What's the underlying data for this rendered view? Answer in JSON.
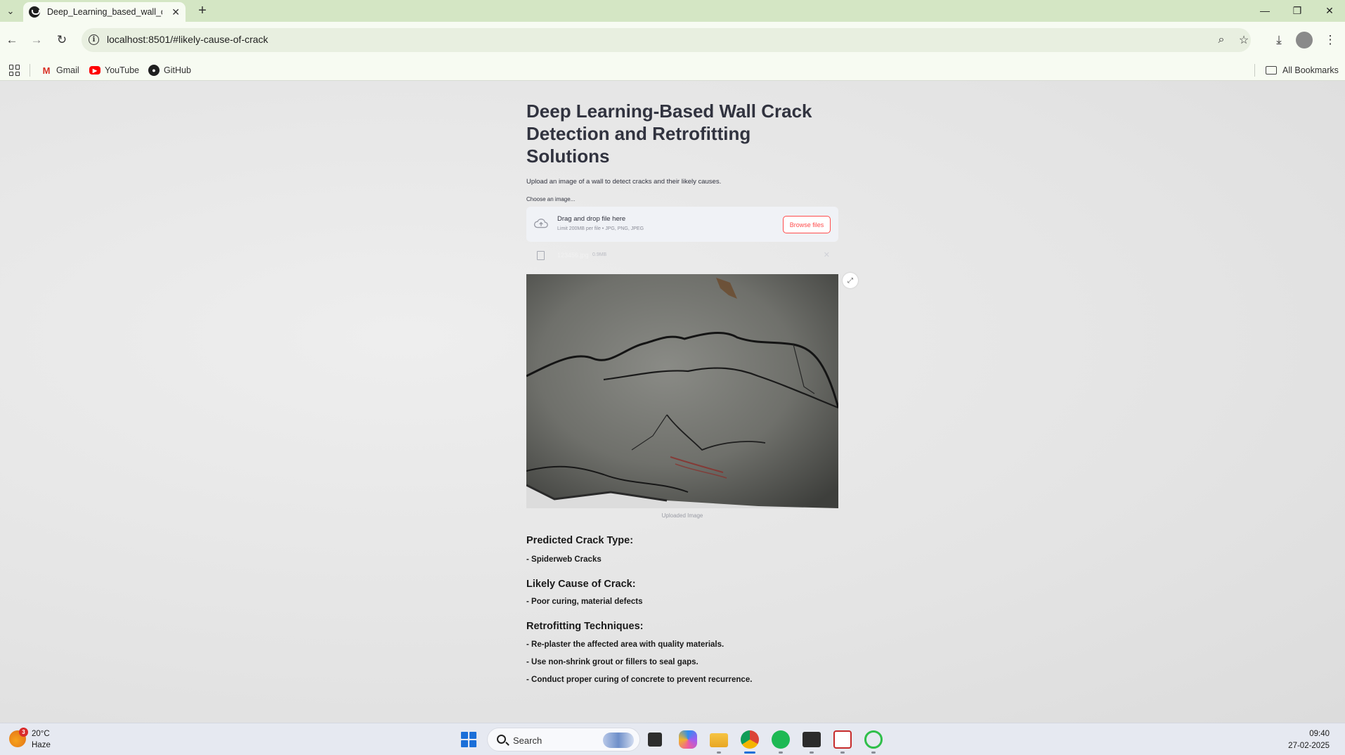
{
  "browser": {
    "tab_title": "Deep_Learning_based_wall_crac",
    "url": "localhost:8501/#likely-cause-of-crack",
    "bookmarks": [
      {
        "label": "Gmail",
        "icon": "gmail-icon"
      },
      {
        "label": "YouTube",
        "icon": "youtube-icon"
      },
      {
        "label": "GitHub",
        "icon": "github-icon"
      }
    ],
    "all_bookmarks": "All Bookmarks"
  },
  "app": {
    "title": "Deep Learning-Based Wall Crack Detection and Retrofitting Solutions",
    "subtitle": "Upload an image of a wall to detect cracks and their likely causes.",
    "uploader_label": "Choose an image...",
    "dropzone_main": "Drag and drop file here",
    "dropzone_sub": "Limit 200MB per file • JPG, PNG, JPEG",
    "browse_label": "Browse files",
    "file_name": "123456.jpg",
    "file_size": "0.9MB",
    "image_caption": "Uploaded Image",
    "predicted_heading": "Predicted Crack Type:",
    "predicted_value": "- Spiderweb Cracks",
    "cause_heading": "Likely Cause of Crack:",
    "cause_value": "- Poor curing, material defects",
    "retrofit_heading": "Retrofitting Techniques:",
    "retrofit_items": [
      "- Re-plaster the affected area with quality materials.",
      "- Use non-shrink grout or fillers to seal gaps.",
      "- Conduct proper curing of concrete to prevent recurrence."
    ]
  },
  "taskbar": {
    "weather_badge": "3",
    "weather_temp": "20°C",
    "weather_condition": "Haze",
    "search_placeholder": "Search",
    "time": "09:40",
    "date": "27-02-2025"
  },
  "colors": {
    "accent": "#ff4b4b",
    "chrome": "#d4e6c4",
    "text": "#31333f"
  }
}
